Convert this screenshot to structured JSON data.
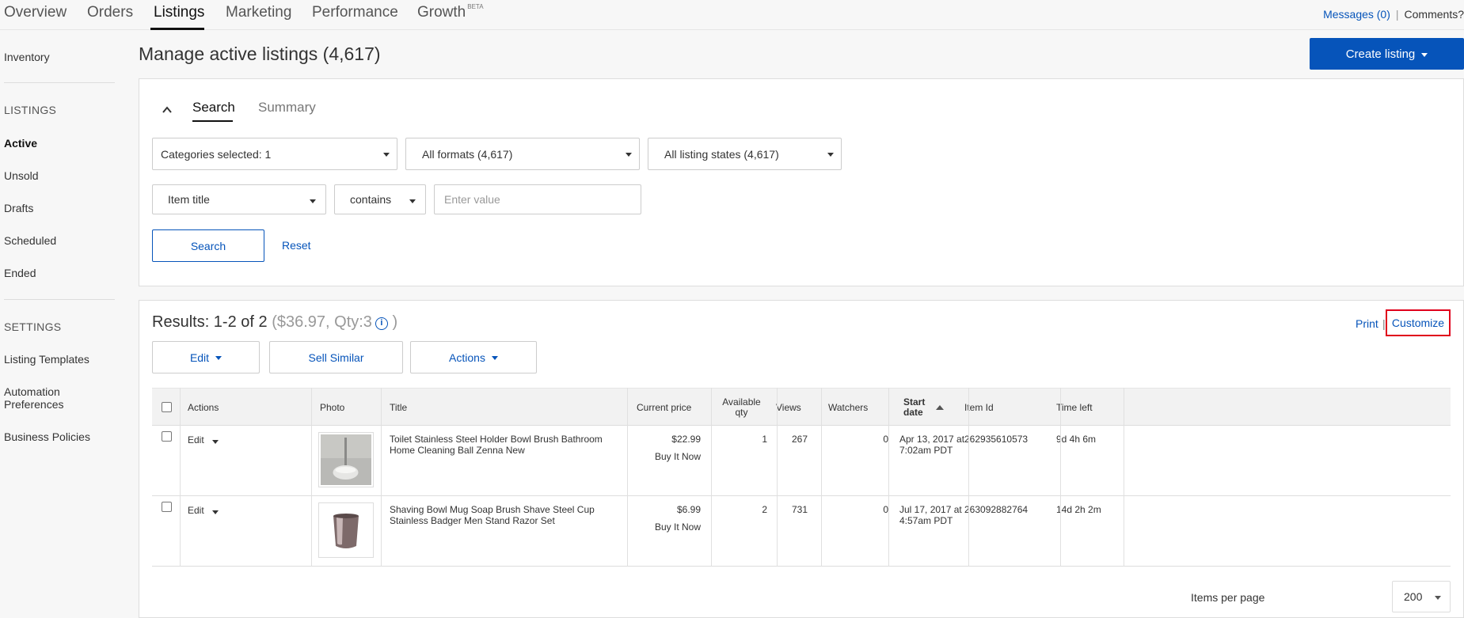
{
  "topnav": {
    "tabs": [
      {
        "label": "Overview"
      },
      {
        "label": "Orders"
      },
      {
        "label": "Listings"
      },
      {
        "label": "Marketing"
      },
      {
        "label": "Performance"
      },
      {
        "label": "Growth",
        "badge": "BETA"
      }
    ],
    "active_tab": "Listings",
    "messages": "Messages (0)",
    "comments": "Comments?"
  },
  "sidebar": {
    "inventory": "Inventory",
    "listings_heading": "LISTINGS",
    "listings": [
      "Active",
      "Unsold",
      "Drafts",
      "Scheduled",
      "Ended"
    ],
    "settings_heading": "SETTINGS",
    "settings": [
      "Listing Templates",
      "Automation Preferences",
      "Business Policies"
    ]
  },
  "header": {
    "title": "Manage active listings (4,617)",
    "create_listing": "Create listing"
  },
  "search_panel": {
    "tab_search": "Search",
    "tab_summary": "Summary",
    "categories": "Categories selected: 1",
    "formats": "All formats (4,617)",
    "states": "All listing states (4,617)",
    "field": "Item title",
    "operator": "contains",
    "value_placeholder": "Enter value",
    "search_button": "Search",
    "reset": "Reset"
  },
  "results": {
    "title": "Results: 1-2 of 2",
    "totals": "($36.97, Qty:3",
    "totals_close": ")",
    "print": "Print",
    "separator": "|",
    "customize": "Customize",
    "edit_button": "Edit",
    "sell_similar_button": "Sell Similar",
    "actions_button": "Actions",
    "columns": {
      "actions": "Actions",
      "photo": "Photo",
      "title": "Title",
      "current_price": "Current price",
      "available_qty_1": "Available",
      "available_qty_2": "qty",
      "views": "Views",
      "watchers": "Watchers",
      "start_date_1": "Start",
      "start_date_2": "date",
      "item_id": "Item Id",
      "time_left": "Time left"
    },
    "rows": [
      {
        "action": "Edit",
        "title_1": "Toilet Stainless Steel Holder Bowl Brush Bathroom",
        "title_2": "Home Cleaning Ball Zenna New",
        "price": "$22.99",
        "format": "Buy It Now",
        "qty": "1",
        "views": "267",
        "watchers": "0",
        "start_1": "Apr 13, 2017 at",
        "start_2": "7:02am PDT",
        "item_id": "262935610573",
        "time_left": "9d 4h 6m"
      },
      {
        "action": "Edit",
        "title_1": "Shaving Bowl Mug Soap Brush Shave Steel Cup",
        "title_2": "Stainless Badger Men Stand Razor Set",
        "price": "$6.99",
        "format": "Buy It Now",
        "qty": "2",
        "views": "731",
        "watchers": "0",
        "start_1": "Jul 17, 2017 at",
        "start_2": "4:57am PDT",
        "item_id": "263092882764",
        "time_left": "14d 2h 2m"
      }
    ],
    "items_per_page_label": "Items per page",
    "items_per_page": "200"
  },
  "colors": {
    "primary": "#0654ba",
    "highlight_border": "#e0001b"
  }
}
